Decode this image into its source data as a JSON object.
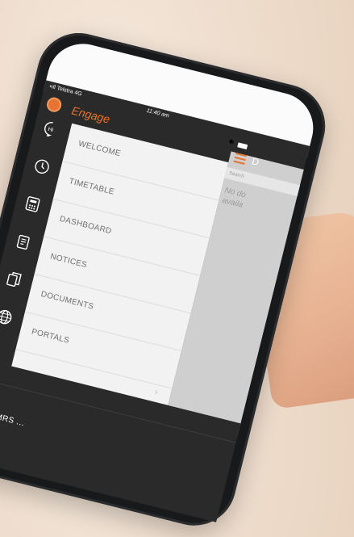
{
  "status_bar": {
    "carrier": "•ıll Telstra  4G",
    "time": "11:40 am",
    "bluetooth_icon": "bluetooth-icon"
  },
  "header": {
    "app_title": "Engage",
    "logo_icon": "engage-logo-icon",
    "accent_color": "#e8722f"
  },
  "sidebar": {
    "items": [
      {
        "label": "WELCOME",
        "icon": "speech-bubble-hi-icon"
      },
      {
        "label": "TIMETABLE",
        "icon": "clock-icon"
      },
      {
        "label": "DASHBOARD",
        "icon": "calculator-icon"
      },
      {
        "label": "NOTICES",
        "icon": "notepad-icon"
      },
      {
        "label": "DOCUMENTS",
        "icon": "documents-icon"
      },
      {
        "label": "PORTALS",
        "icon": "globe-icon"
      }
    ]
  },
  "content": {
    "header_letter": "D",
    "search_placeholder": "Search",
    "empty_text": "No do\navaila"
  },
  "footer": {
    "user_name": "MRS ..."
  }
}
